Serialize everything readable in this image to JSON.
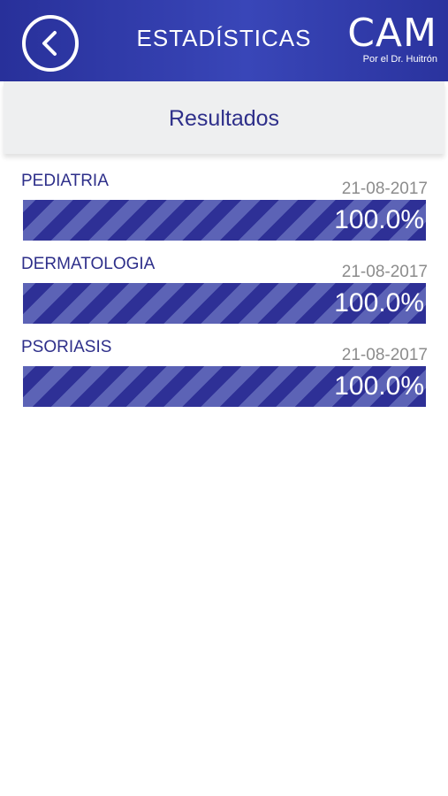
{
  "header": {
    "title": "ESTADÍSTICAS",
    "back_icon": "chevron-left-icon",
    "logo_main": "CAM",
    "logo_sub": "Por el Dr. Huitrón"
  },
  "section": {
    "title": "Resultados"
  },
  "results": [
    {
      "name": "PEDIATRIA",
      "date": "21-08-2017",
      "percent_label": "100.0%",
      "percent": 100.0
    },
    {
      "name": "DERMATOLOGIA",
      "date": "21-08-2017",
      "percent_label": "100.0%",
      "percent": 100.0
    },
    {
      "name": "PSORIASIS",
      "date": "21-08-2017",
      "percent_label": "100.0%",
      "percent": 100.0
    }
  ],
  "colors": {
    "primary": "#2e3096",
    "stripe": "#5c63b6",
    "text_dark": "#2e2f8a",
    "date_gray": "#8c8c8c"
  }
}
